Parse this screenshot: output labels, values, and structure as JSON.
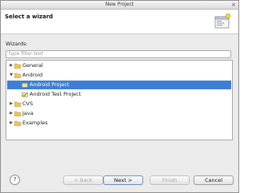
{
  "window": {
    "title": "New Project"
  },
  "header": {
    "heading": "Select a wizard"
  },
  "wizards_label": "Wizards:",
  "filter": {
    "placeholder": "type filter text"
  },
  "tree": {
    "items": [
      {
        "label": "General",
        "expanded": false,
        "icon": "folder-icon"
      },
      {
        "label": "Android",
        "expanded": true,
        "icon": "folder-icon"
      },
      {
        "label": "Android Project",
        "icon": "wizard-icon",
        "selected": true
      },
      {
        "label": "Android Test Project",
        "icon": "wizard-icon"
      },
      {
        "label": "CVS",
        "expanded": false,
        "icon": "folder-icon"
      },
      {
        "label": "Java",
        "expanded": false,
        "icon": "folder-icon"
      },
      {
        "label": "Examples",
        "expanded": false,
        "icon": "folder-icon"
      }
    ]
  },
  "buttons": {
    "back": "< Back",
    "next": "Next >",
    "finish": "Finish",
    "cancel": "Cancel"
  },
  "colors": {
    "selection": "#3f7fd1"
  }
}
